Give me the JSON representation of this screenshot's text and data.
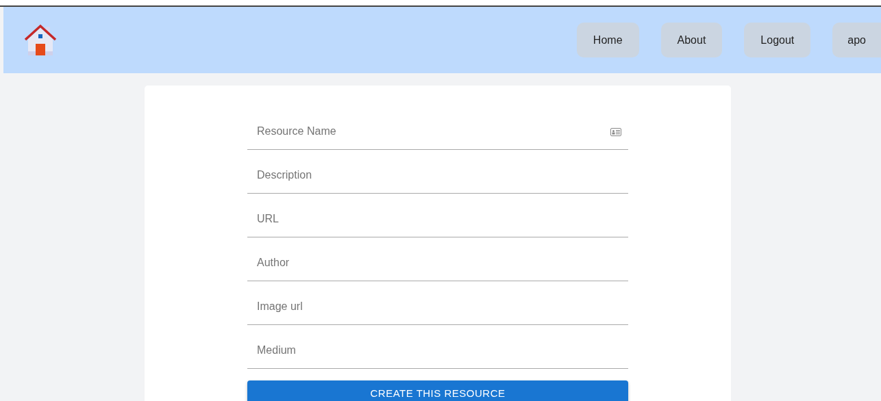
{
  "nav": {
    "items": [
      {
        "label": "Home"
      },
      {
        "label": "About"
      },
      {
        "label": "Logout"
      },
      {
        "label": "apo"
      }
    ]
  },
  "form": {
    "fields": [
      {
        "placeholder": "Resource Name",
        "autofill_icon": true
      },
      {
        "placeholder": "Description",
        "autofill_icon": false
      },
      {
        "placeholder": "URL",
        "autofill_icon": false
      },
      {
        "placeholder": "Author",
        "autofill_icon": false
      },
      {
        "placeholder": "Image url",
        "autofill_icon": false
      },
      {
        "placeholder": "Medium",
        "autofill_icon": false
      }
    ],
    "submit": "CREATE THIS RESOURCE"
  }
}
